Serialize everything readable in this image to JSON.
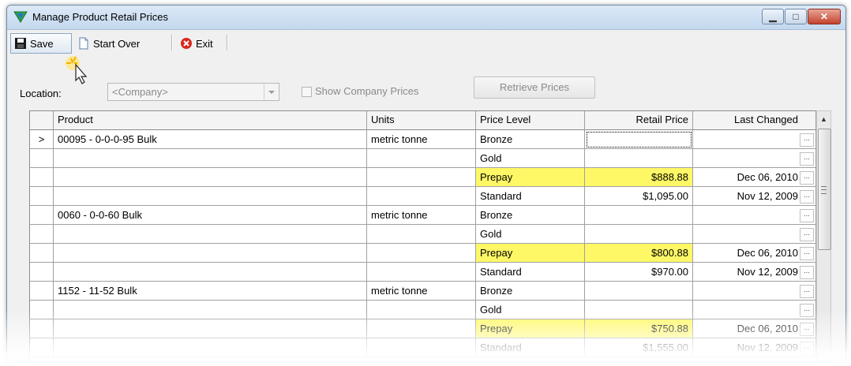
{
  "window": {
    "title": "Manage Product Retail Prices"
  },
  "toolbar": {
    "save_label": "Save",
    "start_over_label": "Start Over",
    "exit_label": "Exit"
  },
  "filter": {
    "location_label": "Location:",
    "location_value": "<Company>",
    "show_company_prices_label": "Show Company Prices",
    "retrieve_label": "Retrieve Prices"
  },
  "grid": {
    "columns": [
      "",
      "Product",
      "Units",
      "Price Level",
      "Retail Price",
      "Last Changed"
    ],
    "rows": [
      {
        "indicator": ">",
        "product": "00095 - 0-0-0-95 Bulk",
        "units": "metric tonne",
        "level": "Bronze",
        "price": "",
        "changed": ""
      },
      {
        "indicator": "",
        "product": "",
        "units": "",
        "level": "Gold",
        "price": "",
        "changed": ""
      },
      {
        "indicator": "",
        "product": "",
        "units": "",
        "level": "Prepay",
        "price": "$888.88",
        "changed": "Dec 06, 2010"
      },
      {
        "indicator": "",
        "product": "",
        "units": "",
        "level": "Standard",
        "price": "$1,095.00",
        "changed": "Nov 12, 2009"
      },
      {
        "indicator": "",
        "product": "0060 - 0-0-60 Bulk",
        "units": "metric tonne",
        "level": "Bronze",
        "price": "",
        "changed": ""
      },
      {
        "indicator": "",
        "product": "",
        "units": "",
        "level": "Gold",
        "price": "",
        "changed": ""
      },
      {
        "indicator": "",
        "product": "",
        "units": "",
        "level": "Prepay",
        "price": "$800.88",
        "changed": "Dec 06, 2010"
      },
      {
        "indicator": "",
        "product": "",
        "units": "",
        "level": "Standard",
        "price": "$970.00",
        "changed": "Nov 12, 2009"
      },
      {
        "indicator": "",
        "product": "1152 - 11-52 Bulk",
        "units": "metric tonne",
        "level": "Bronze",
        "price": "",
        "changed": ""
      },
      {
        "indicator": "",
        "product": "",
        "units": "",
        "level": "Gold",
        "price": "",
        "changed": ""
      },
      {
        "indicator": "",
        "product": "",
        "units": "",
        "level": "Prepay",
        "price": "$750.88",
        "changed": "Dec 06, 2010"
      },
      {
        "indicator": "",
        "product": "",
        "units": "",
        "level": "Standard",
        "price": "$1,555.00",
        "changed": "Nov 12, 2009"
      }
    ],
    "ellipsis": "..."
  },
  "colors": {
    "highlight": "#fff866",
    "title_gradient_top": "#dce9f7",
    "close_button": "#c4432f"
  }
}
